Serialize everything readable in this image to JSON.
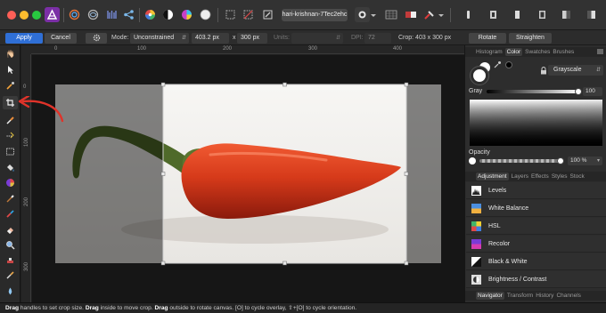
{
  "toolbar_top": {
    "file_tab": "hari-krishnan-7Tec2ehc"
  },
  "context_bar": {
    "apply_label": "Apply",
    "cancel_label": "Cancel",
    "mode_label": "Mode:",
    "mode_value": "Unconstrained",
    "width_value": "403.2 px",
    "times": "x",
    "height_value": "300 px",
    "units_label": "Units:",
    "dpi_label": "DPI:",
    "dpi_value": "72",
    "crop_label": "Crop: 403 x 300 px",
    "rotate_label": "Rotate",
    "straighten_label": "Straighten"
  },
  "rulers": {
    "horizontal": [
      "0",
      "100",
      "200",
      "300",
      "400"
    ],
    "vertical": [
      "0",
      "100",
      "200",
      "300"
    ]
  },
  "color_panel": {
    "tabs": [
      {
        "label": "Histogram",
        "active": false
      },
      {
        "label": "Color",
        "active": true
      },
      {
        "label": "Swatches",
        "active": false
      },
      {
        "label": "Brushes",
        "active": false
      }
    ],
    "model_value": "Grayscale",
    "gray_label": "Gray",
    "gray_value": "100",
    "opacity_label": "Opacity",
    "opacity_value": "100 %"
  },
  "adjustment_panel": {
    "tabs": [
      {
        "label": "Adjustment",
        "active": true
      },
      {
        "label": "Layers",
        "active": false
      },
      {
        "label": "Effects",
        "active": false
      },
      {
        "label": "Styles",
        "active": false
      },
      {
        "label": "Stock",
        "active": false
      }
    ],
    "items": [
      {
        "label": "Levels"
      },
      {
        "label": "White Balance"
      },
      {
        "label": "HSL"
      },
      {
        "label": "Recolor"
      },
      {
        "label": "Black & White"
      },
      {
        "label": "Brightness / Contrast"
      }
    ]
  },
  "navigator_panel": {
    "tabs": [
      {
        "label": "Navigator",
        "active": true
      },
      {
        "label": "Transform",
        "active": false
      },
      {
        "label": "History",
        "active": false
      },
      {
        "label": "Channels",
        "active": false
      }
    ]
  },
  "status": {
    "s1": "Drag",
    "s2": " handles to set crop size. ",
    "s3": "Drag",
    "s4": " inside to move crop. ",
    "s5": "Drag",
    "s6": " outside to rotate canvas. [O] to cycle overlay, ",
    "s7": "⇧+[O] to cycle orientation."
  },
  "colors": {
    "accent": "#2f6fd6",
    "annotation_arrow": "#e0332a",
    "pepper_red": "#d8391c",
    "stem_green": "#4f6a2a"
  }
}
